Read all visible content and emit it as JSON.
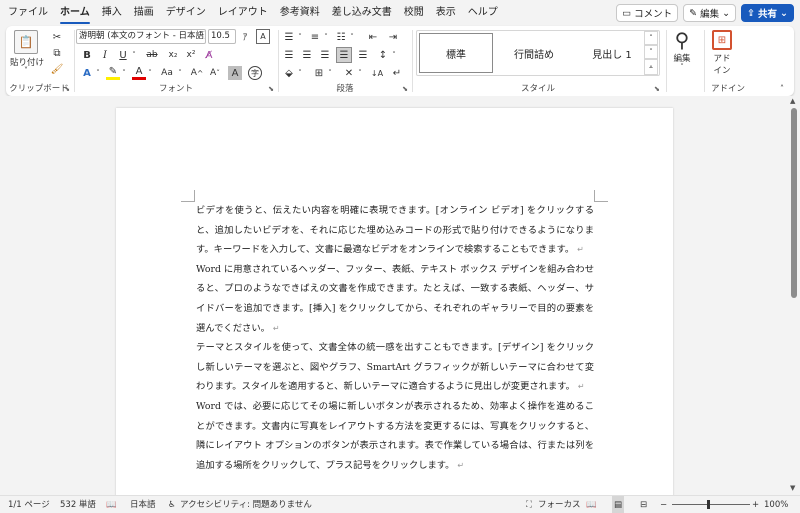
{
  "menu": {
    "tabs": [
      "ファイル",
      "ホーム",
      "挿入",
      "描画",
      "デザイン",
      "レイアウト",
      "参考資料",
      "差し込み文書",
      "校閲",
      "表示",
      "ヘルプ"
    ],
    "active_tab": "ホーム",
    "comment_label": "コメント",
    "edit_label": "編集",
    "share_label": "共有"
  },
  "ribbon": {
    "clipboard": {
      "paste_label": "貼り付け",
      "group_label": "クリップボード"
    },
    "font": {
      "font_name": "游明朝 (本文のフォント - 日本語)",
      "font_size": "10.5",
      "group_label": "フォント",
      "bold": "B",
      "italic": "I",
      "underline": "U",
      "strike": "ab",
      "subscript": "x₂",
      "superscript": "x²",
      "grow": "A^",
      "shrink": "A˅",
      "case": "Aa",
      "clear": "A"
    },
    "paragraph": {
      "group_label": "段落"
    },
    "styles": {
      "items": [
        "標準",
        "行間詰め",
        "見出し 1"
      ],
      "group_label": "スタイル"
    },
    "editing": {
      "label": "編集"
    },
    "addins": {
      "label_line1": "アド",
      "label_line2": "イン",
      "group_label": "アドイン"
    }
  },
  "document": {
    "paragraphs": [
      "ビデオを使うと、伝えたい内容を明確に表現できます。[オンライン ビデオ] をクリックすると、追加したいビデオを、それに応じた埋め込みコードの形式で貼り付けできるようになります。キーワードを入力して、文書に最適なビデオをオンラインで検索することもできます。",
      "Word に用意されているヘッダー、フッター、表紙、テキスト ボックス デザインを組み合わせると、プロのようなできばえの文書を作成できます。たとえば、一致する表紙、ヘッダー、サイドバーを追加できます。[挿入] をクリックしてから、それぞれのギャラリーで目的の要素を選んでください。",
      "テーマとスタイルを使って、文書全体の統一感を出すこともできます。[デザイン] をクリックし新しいテーマを選ぶと、図やグラフ、SmartArt グラフィックが新しいテーマに合わせて変わります。スタイルを適用すると、新しいテーマに適合するように見出しが変更されます。",
      "Word では、必要に応じてその場に新しいボタンが表示されるため、効率よく操作を進めることができます。文書内に写真をレイアウトする方法を変更するには、写真をクリックすると、隣にレイアウト オプションのボタンが表示されます。表で作業している場合は、行または列を追加する場所をクリックして、プラス記号をクリックします。"
    ],
    "para_mark": "↵"
  },
  "status": {
    "page": "1/1 ページ",
    "words": "532 単語",
    "language": "日本語",
    "accessibility": "アクセシビリティ: 問題ありません",
    "focus": "フォーカス",
    "zoom": "100%"
  }
}
